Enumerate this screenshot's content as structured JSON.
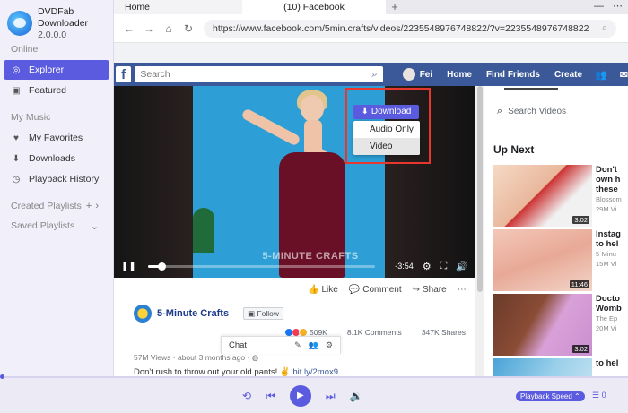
{
  "app": {
    "name": "DVDFab Downloader",
    "version": "2.0.0.0"
  },
  "sidebar": {
    "online_label": "Online",
    "online_items": [
      {
        "label": "Explorer",
        "icon": "globe-icon"
      },
      {
        "label": "Featured",
        "icon": "featured-icon"
      }
    ],
    "music_label": "My Music",
    "music_items": [
      {
        "label": "My Favorites",
        "icon": "heart-icon"
      },
      {
        "label": "Downloads",
        "icon": "download-icon"
      },
      {
        "label": "Playback History",
        "icon": "clock-icon"
      }
    ],
    "created_playlists": "Created Playlists",
    "saved_playlists": "Saved Playlists"
  },
  "tabs": [
    {
      "label": "Home"
    },
    {
      "label": "(10) Facebook"
    }
  ],
  "address": {
    "url": "https://www.facebook.com/5min.crafts/videos/2235548976748822/?v=2235548976748822"
  },
  "fb": {
    "search_placeholder": "Search",
    "user": "Fei",
    "nav": [
      "Home",
      "Find Friends",
      "Create"
    ]
  },
  "video": {
    "watermark": "5-MINUTE CRAFTS",
    "time_remaining": "-3:54",
    "progress": 0.06
  },
  "download": {
    "button_label": "Download",
    "options": [
      "Audio Only",
      "Video"
    ],
    "selected_index": 1
  },
  "post": {
    "actions": [
      "Like",
      "Comment",
      "Share"
    ],
    "page_name": "5-Minute Crafts",
    "follow_label": "Follow",
    "reactions_count": "509K",
    "comments": "8.1K Comments",
    "shares": "347K Shares",
    "meta": "57M Views · about 3 months ago ·",
    "caption": "Don't rush to throw out your old pants! ",
    "caption_link": "bit.ly/2mox9"
  },
  "chat": {
    "label": "Chat"
  },
  "watch": {
    "search_placeholder": "Search Videos"
  },
  "up_next": {
    "title": "Up Next",
    "items": [
      {
        "title": "Don't",
        "subtitle": "own h",
        "subtitle2": "these",
        "channel": "Blossom",
        "views": "29M Vi",
        "duration": "3:02"
      },
      {
        "title": "Instag",
        "subtitle": "to hel",
        "subtitle2": "5-Minu",
        "channel": "",
        "views": "15M Vi",
        "duration": "11:46"
      },
      {
        "title": "Docto",
        "subtitle": "Womb",
        "subtitle2": "The Ep",
        "channel": "",
        "views": "20M Vi",
        "duration": "3:02"
      },
      {
        "title": "to hel",
        "subtitle": "",
        "subtitle2": "",
        "channel": "",
        "views": "",
        "duration": ""
      }
    ]
  },
  "player": {
    "speed_label": "Playback Speed",
    "queue_count": "0",
    "accent": "#5b5be0"
  }
}
